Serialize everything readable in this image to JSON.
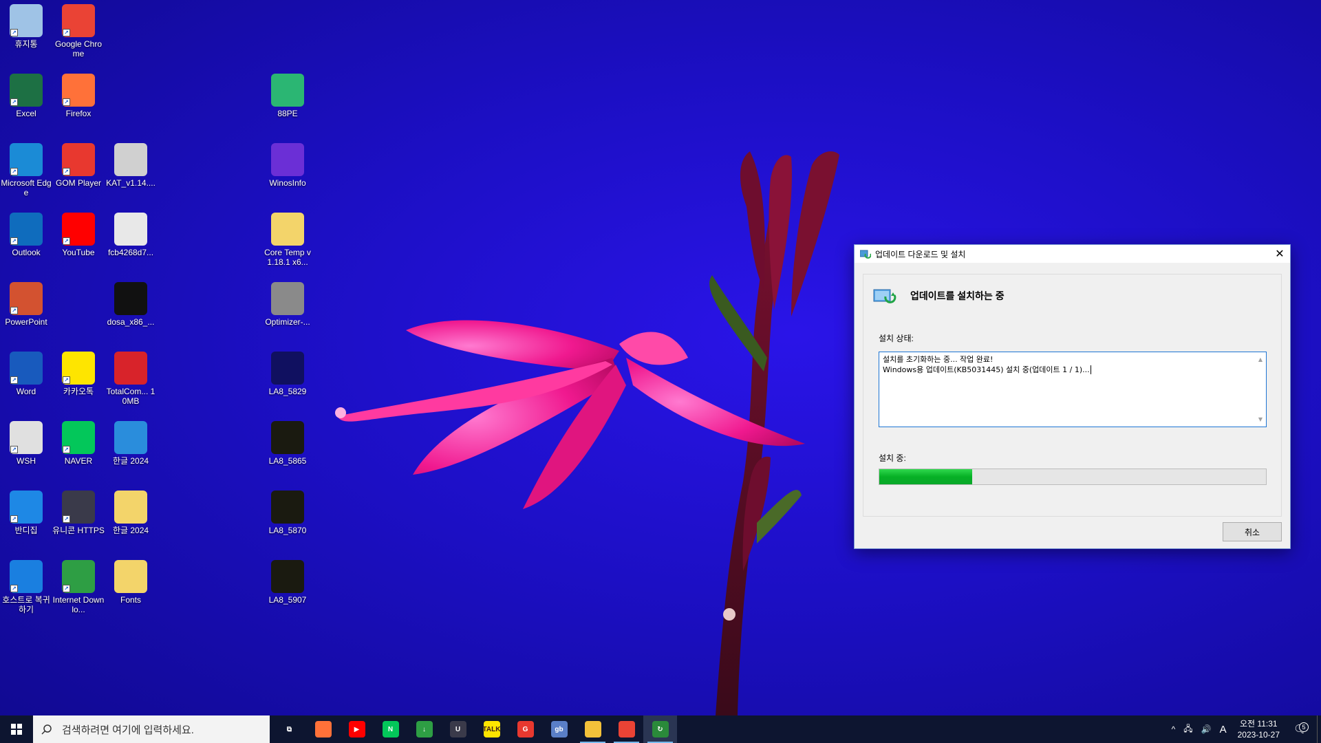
{
  "desktop": {
    "icons": [
      {
        "label": "휴지통",
        "icon": "recycle-bin-icon",
        "color": "#9fc3e6"
      },
      {
        "label": "Google Chrome",
        "icon": "chrome-icon",
        "color": "#ea4335"
      },
      {
        "label": "Excel",
        "icon": "excel-icon",
        "color": "#1d7044"
      },
      {
        "label": "Firefox",
        "icon": "firefox-icon",
        "color": "#ff7139"
      },
      {
        "label": "88PE",
        "icon": "88pe-icon",
        "color": "#2bb673"
      },
      {
        "label": "Microsoft Edge",
        "icon": "edge-icon",
        "color": "#1b8bd6"
      },
      {
        "label": "GOM Player",
        "icon": "gom-player-icon",
        "color": "#e8382f"
      },
      {
        "label": "KAT_v1.14....",
        "icon": "kat-icon",
        "color": "#d0d0d0"
      },
      {
        "label": "WinosInfo",
        "icon": "winosinfo-icon",
        "color": "#6b2fd6"
      },
      {
        "label": "Outlook",
        "icon": "outlook-icon",
        "color": "#0f6cbd"
      },
      {
        "label": "YouTube",
        "icon": "youtube-icon",
        "color": "#ff0000"
      },
      {
        "label": "fcb4268d7...",
        "icon": "document-icon",
        "color": "#e8e8e8"
      },
      {
        "label": "Core Temp v1.18.1 x6...",
        "icon": "folder-icon",
        "color": "#f3d46a"
      },
      {
        "label": "PowerPoint",
        "icon": "powerpoint-icon",
        "color": "#d35230"
      },
      {
        "label": "dosa_x86_...",
        "icon": "dosa-icon",
        "color": "#111111"
      },
      {
        "label": "Optimizer-...",
        "icon": "checkmark-icon",
        "color": "#8a8a8a"
      },
      {
        "label": "Word",
        "icon": "word-icon",
        "color": "#185abd"
      },
      {
        "label": "카카오톡",
        "icon": "kakaotalk-icon",
        "color": "#fee500"
      },
      {
        "label": "TotalCom... 10MB",
        "icon": "totalcommander-icon",
        "color": "#d8232a"
      },
      {
        "label": "LA8_5829",
        "icon": "image-thumb-icon",
        "color": "#101060"
      },
      {
        "label": "WSH",
        "icon": "wsh-icon",
        "color": "#e0e0e0"
      },
      {
        "label": "NAVER",
        "icon": "naver-icon",
        "color": "#03c75a"
      },
      {
        "label": "한글 2024",
        "icon": "hangul-icon",
        "color": "#2a8ddc"
      },
      {
        "label": "LA8_5865",
        "icon": "image-thumb-icon",
        "color": "#1a1a10"
      },
      {
        "label": "반디집",
        "icon": "bandizip-icon",
        "color": "#1e88e5"
      },
      {
        "label": "유니콘 HTTPS",
        "icon": "unicorn-https-icon",
        "color": "#3a3a4a"
      },
      {
        "label": "한글 2024",
        "icon": "folder-icon",
        "color": "#f3d46a"
      },
      {
        "label": "LA8_5870",
        "icon": "image-thumb-icon",
        "color": "#1a1a10"
      },
      {
        "label": "호스트로 복귀하기",
        "icon": "host-return-icon",
        "color": "#1a7fe0"
      },
      {
        "label": "Internet Downlo...",
        "icon": "idm-icon",
        "color": "#2e9e44"
      },
      {
        "label": "Fonts",
        "icon": "folder-icon",
        "color": "#f3d46a"
      },
      {
        "label": "LA8_5907",
        "icon": "image-thumb-icon",
        "color": "#1a1a10"
      }
    ]
  },
  "dialog": {
    "title": "업데이트 다운로드 및 설치",
    "heading": "업데이트를 설치하는 중",
    "status_label": "설치 상태:",
    "log_line1": "설치를 초기화하는 중... 작업 완료!",
    "log_line2": "Windows용 업데이트(KB5031445) 설치 중(업데이트 1 / 1)...",
    "progress_label": "설치 중:",
    "progress_fraction": 0.24,
    "cancel_label": "취소",
    "accent_color": "#06b025"
  },
  "taskbar": {
    "search_placeholder": "검색하려면 여기에 입력하세요.",
    "apps": [
      {
        "icon": "task-view-icon",
        "color": "#0d1530",
        "glyph": "⧉"
      },
      {
        "icon": "firefox-icon",
        "color": "#ff7139",
        "glyph": ""
      },
      {
        "icon": "youtube-icon",
        "color": "#ff0000",
        "glyph": "▶"
      },
      {
        "icon": "naver-icon",
        "color": "#03c75a",
        "glyph": "N"
      },
      {
        "icon": "idm-icon",
        "color": "#2e9e44",
        "glyph": "↓"
      },
      {
        "icon": "unicorn-https-icon",
        "color": "#3a3a4a",
        "glyph": "U"
      },
      {
        "icon": "kakaotalk-icon",
        "color": "#fee500",
        "glyph": "TALK"
      },
      {
        "icon": "gom-player-icon",
        "color": "#e8382f",
        "glyph": "G"
      },
      {
        "icon": "gb-icon",
        "color": "#5a7fc8",
        "glyph": "gb"
      },
      {
        "icon": "file-explorer-icon",
        "color": "#f3c13a",
        "glyph": ""
      },
      {
        "icon": "chrome-icon",
        "color": "#ea4335",
        "glyph": ""
      },
      {
        "icon": "windows-update-icon",
        "color": "#2a8a3a",
        "glyph": "↻"
      }
    ],
    "tray": {
      "ime": "A",
      "time": "오전 11:31",
      "date": "2023-10-27",
      "notification_count": "5"
    }
  }
}
